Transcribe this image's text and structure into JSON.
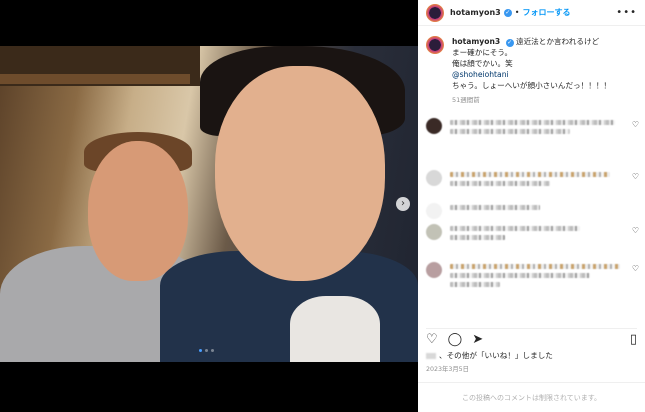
{
  "header": {
    "username": "hotamyon3",
    "follow_label": "フォローする",
    "separator": "•",
    "more_label": "•••"
  },
  "caption": {
    "username": "hotamyon3",
    "lines": [
      "遠近法とか言われるけど",
      "まー確かにそう。",
      "俺は顔でかい。笑"
    ],
    "mention": "@shoheiohtani",
    "last_line": "ちゃう。しょーへいが顔小さいんだっ！！！！",
    "time_ago": "51週間前"
  },
  "icons": {
    "verified": "verified-badge-icon",
    "heart": "heart-icon",
    "comment": "comment-icon",
    "share": "share-icon",
    "save": "bookmark-icon",
    "next": "chevron-right-icon"
  },
  "likes_text": "、その他が「いいね！」しました",
  "date": "2023年3月5日",
  "comments_limited": "この投稿へのコメントは制限されています。",
  "carousel": {
    "total": 3,
    "active": 0
  },
  "colors": {
    "accent": "#0095f6",
    "verified": "#3897f0",
    "carousel_active": "#4a9eff"
  }
}
